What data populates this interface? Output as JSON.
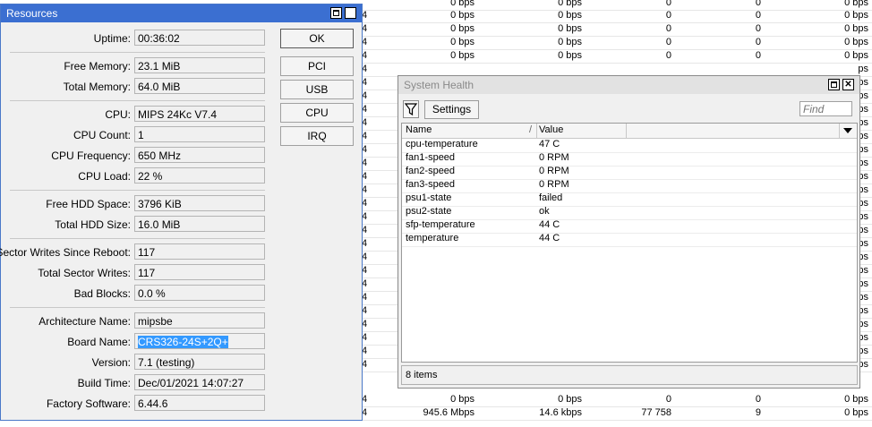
{
  "background_table": {
    "rows": [
      [
        "",
        "0 bps",
        "0 bps",
        "0",
        "0",
        "0 bps"
      ],
      [
        "4",
        "0 bps",
        "0 bps",
        "0",
        "0",
        "0 bps"
      ],
      [
        "4",
        "0 bps",
        "0 bps",
        "0",
        "0",
        "0 bps"
      ],
      [
        "4",
        "0 bps",
        "0 bps",
        "0",
        "0",
        "0 bps"
      ],
      [
        "4",
        "0 bps",
        "0 bps",
        "0",
        "0",
        "0 bps"
      ],
      [
        "4",
        "",
        "",
        "",
        "",
        "ps"
      ],
      [
        "4",
        "",
        "",
        "",
        "",
        "ps"
      ],
      [
        "4",
        "",
        "",
        "",
        "",
        "ps"
      ],
      [
        "4",
        "",
        "",
        "",
        "",
        "ps"
      ],
      [
        "4",
        "",
        "",
        "",
        "",
        "ps"
      ],
      [
        "4",
        "",
        "",
        "",
        "",
        "ps"
      ],
      [
        "4",
        "",
        "",
        "",
        "",
        "ps"
      ],
      [
        "4",
        "",
        "",
        "",
        "",
        "ps"
      ],
      [
        "4",
        "",
        "",
        "",
        "",
        "ps"
      ],
      [
        "4",
        "",
        "",
        "",
        "",
        "ps"
      ],
      [
        "4",
        "",
        "",
        "",
        "",
        "ps"
      ],
      [
        "4",
        "",
        "",
        "",
        "",
        "ps"
      ],
      [
        "4",
        "",
        "",
        "",
        "",
        "ps"
      ],
      [
        "4",
        "",
        "",
        "",
        "",
        "ps"
      ],
      [
        "4",
        "",
        "",
        "",
        "",
        "ps"
      ],
      [
        "4",
        "",
        "",
        "",
        "",
        "ps"
      ],
      [
        "4",
        "",
        "",
        "",
        "",
        "ps"
      ],
      [
        "4",
        "",
        "",
        "",
        "",
        "ps"
      ],
      [
        "4",
        "",
        "",
        "",
        "",
        "ps"
      ],
      [
        "4",
        "",
        "",
        "",
        "",
        "ps"
      ],
      [
        "4",
        "",
        "",
        "",
        "",
        "ps"
      ],
      [
        "4",
        "",
        "",
        "",
        "",
        "ps"
      ],
      [
        "4",
        "",
        "",
        "",
        "",
        "ps"
      ],
      [
        "4",
        "0 bps",
        "0 bps",
        "0",
        "0",
        "0 bps"
      ],
      [
        "4",
        "945.6 Mbps",
        "14.6 kbps",
        "77 758",
        "9",
        "0 bps"
      ]
    ]
  },
  "resources": {
    "title": "Resources",
    "buttons": {
      "ok": "OK",
      "pci": "PCI",
      "usb": "USB",
      "cpu": "CPU",
      "irq": "IRQ"
    },
    "fields": {
      "uptime": {
        "label": "Uptime:",
        "value": "00:36:02"
      },
      "free_memory": {
        "label": "Free Memory:",
        "value": "23.1 MiB"
      },
      "total_memory": {
        "label": "Total Memory:",
        "value": "64.0 MiB"
      },
      "cpu": {
        "label": "CPU:",
        "value": "MIPS 24Kc V7.4"
      },
      "cpu_count": {
        "label": "CPU Count:",
        "value": "1"
      },
      "cpu_frequency": {
        "label": "CPU Frequency:",
        "value": "650 MHz"
      },
      "cpu_load": {
        "label": "CPU Load:",
        "value": "22 %"
      },
      "free_hdd": {
        "label": "Free HDD Space:",
        "value": "3796 KiB"
      },
      "total_hdd": {
        "label": "Total HDD Size:",
        "value": "16.0 MiB"
      },
      "sector_writes_reboot": {
        "label": "Sector Writes Since Reboot:",
        "value": "117"
      },
      "total_sector_writes": {
        "label": "Total Sector Writes:",
        "value": "117"
      },
      "bad_blocks": {
        "label": "Bad Blocks:",
        "value": "0.0 %"
      },
      "architecture": {
        "label": "Architecture Name:",
        "value": "mipsbe"
      },
      "board_name": {
        "label": "Board Name:",
        "value": "CRS326-24S+2Q+"
      },
      "version": {
        "label": "Version:",
        "value": "7.1 (testing)"
      },
      "build_time": {
        "label": "Build Time:",
        "value": "Dec/01/2021 14:07:27"
      },
      "factory_software": {
        "label": "Factory Software:",
        "value": "6.44.6"
      }
    }
  },
  "system_health": {
    "title": "System Health",
    "settings_label": "Settings",
    "find_placeholder": "Find",
    "columns": {
      "name": "Name",
      "value": "Value",
      "sort_marker": "/"
    },
    "rows": [
      {
        "name": "cpu-temperature",
        "value": "47 C"
      },
      {
        "name": "fan1-speed",
        "value": "0 RPM"
      },
      {
        "name": "fan2-speed",
        "value": "0 RPM"
      },
      {
        "name": "fan3-speed",
        "value": "0 RPM"
      },
      {
        "name": "psu1-state",
        "value": "failed"
      },
      {
        "name": "psu2-state",
        "value": "ok"
      },
      {
        "name": "sfp-temperature",
        "value": "44 C"
      },
      {
        "name": "temperature",
        "value": "44 C"
      }
    ],
    "status": "8 items"
  },
  "icons": {
    "filter": "filter-icon",
    "dropdown": "chevron-down-icon",
    "maximize": "maximize-icon",
    "close": "close-icon"
  }
}
